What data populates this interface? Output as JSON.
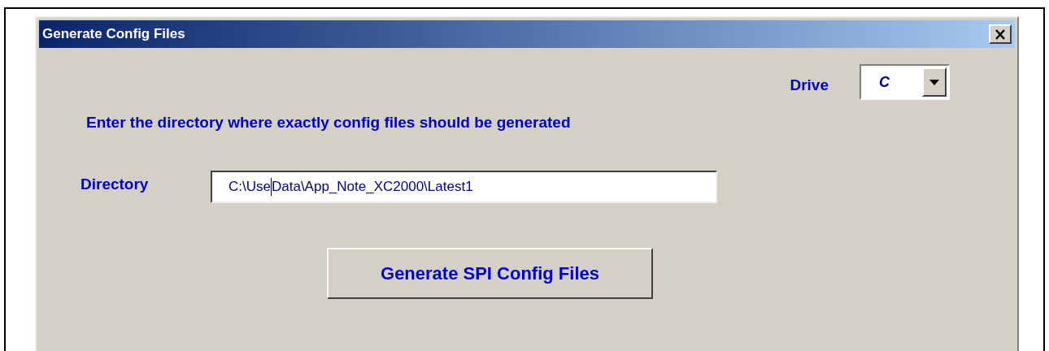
{
  "window": {
    "title": "Generate Config Files"
  },
  "drive": {
    "label": "Drive",
    "value": "C"
  },
  "instruction": "Enter the directory where exactly config files should be generated",
  "directory": {
    "label": "Directory",
    "value_before_caret": "C:\\Use",
    "value_after_caret": "Data\\App_Note_XC2000\\Latest1"
  },
  "buttons": [
    {
      "label": "Generate SPI Config Files"
    }
  ]
}
